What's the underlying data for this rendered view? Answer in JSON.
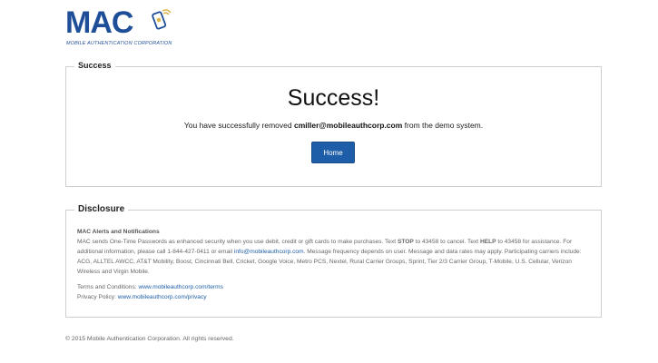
{
  "logo": {
    "text": "MAC",
    "tagline": "MOBILE AUTHENTICATION CORPORATION",
    "brand_color": "#1f4e99",
    "accent_color": "#d9b44a",
    "icon": "phone-lock-icon"
  },
  "success": {
    "legend": "Success",
    "heading": "Success!",
    "message_before": "You have successfully removed",
    "email": "cmiller@mobileauthcorp.com",
    "message_after": "from the demo system.",
    "home_button": "Home",
    "button_color": "#1e5ea8"
  },
  "disclosure": {
    "legend": "Disclosure",
    "title": "MAC Alerts and Notifications",
    "p1_a": "MAC sends One-Time Passwords as enhanced security when you use debit, credit or gift cards to make purchases. Text ",
    "stop_word": "STOP",
    "p1_b": " to 43458 to cancel. Text ",
    "help_word": "HELP",
    "p1_c": " to 43458 for assistance. For additional information, please call 1-844-427-0411 or email ",
    "email_link": "info@mobileauthcorp.com",
    "p1_d": ". Message frequency depends on user. Message and data rates may apply. Participating carriers include: ACG, ALLTEL AWCC, AT&T Mobility, Boost, Cincinnati Bell, Cricket, Google Voice, Metro PCS, Nextel, Rural Carrier Groups, Sprint, Tier 2/3 Carrier Group, T-Mobile, U.S. Cellular, Verizon Wireless and Virgin Mobile.",
    "terms_label": "Terms and Conditions:",
    "terms_link": "www.mobileauthcorp.com/terms",
    "privacy_label": "Privacy Policy:",
    "privacy_link": "www.mobileauthcorp.com/privacy"
  },
  "footer": {
    "copyright": "© 2015 Mobile Authentication Corporation. All rights reserved."
  }
}
